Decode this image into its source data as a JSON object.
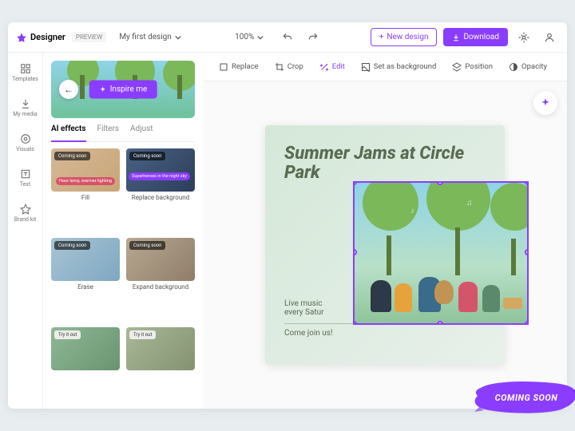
{
  "app": {
    "name": "Designer",
    "preview": "PREVIEW",
    "design_name": "My first design"
  },
  "topbar": {
    "zoom": "100%",
    "new_design": "New design",
    "download": "Download"
  },
  "rail": {
    "templates": "Templates",
    "my_media": "My media",
    "visuals": "Visuals",
    "text": "Text",
    "brand_kit": "Brand kit"
  },
  "panel": {
    "inspire": "Inspire me",
    "tabs": {
      "ai": "AI effects",
      "filters": "Filters",
      "adjust": "Adjust"
    },
    "badges": {
      "coming_soon": "Coming soon",
      "try_it": "Try it out"
    },
    "pills": {
      "warm": "Hour lamp, warmer lighting",
      "night": "Superheroes in the night sky"
    },
    "cards": {
      "fill": "Fill",
      "replace_bg": "Replace background",
      "erase": "Erase",
      "expand_bg": "Expand background"
    }
  },
  "ctx": {
    "replace": "Replace",
    "crop": "Crop",
    "edit": "Edit",
    "set_bg": "Set as background",
    "position": "Position",
    "opacity": "Opacity"
  },
  "poster": {
    "title": "Summer Jams at Circle Park",
    "sub1": "Live music",
    "sub2": "every Satur",
    "cta": "Come join us!"
  },
  "banner": "COMING SOON"
}
